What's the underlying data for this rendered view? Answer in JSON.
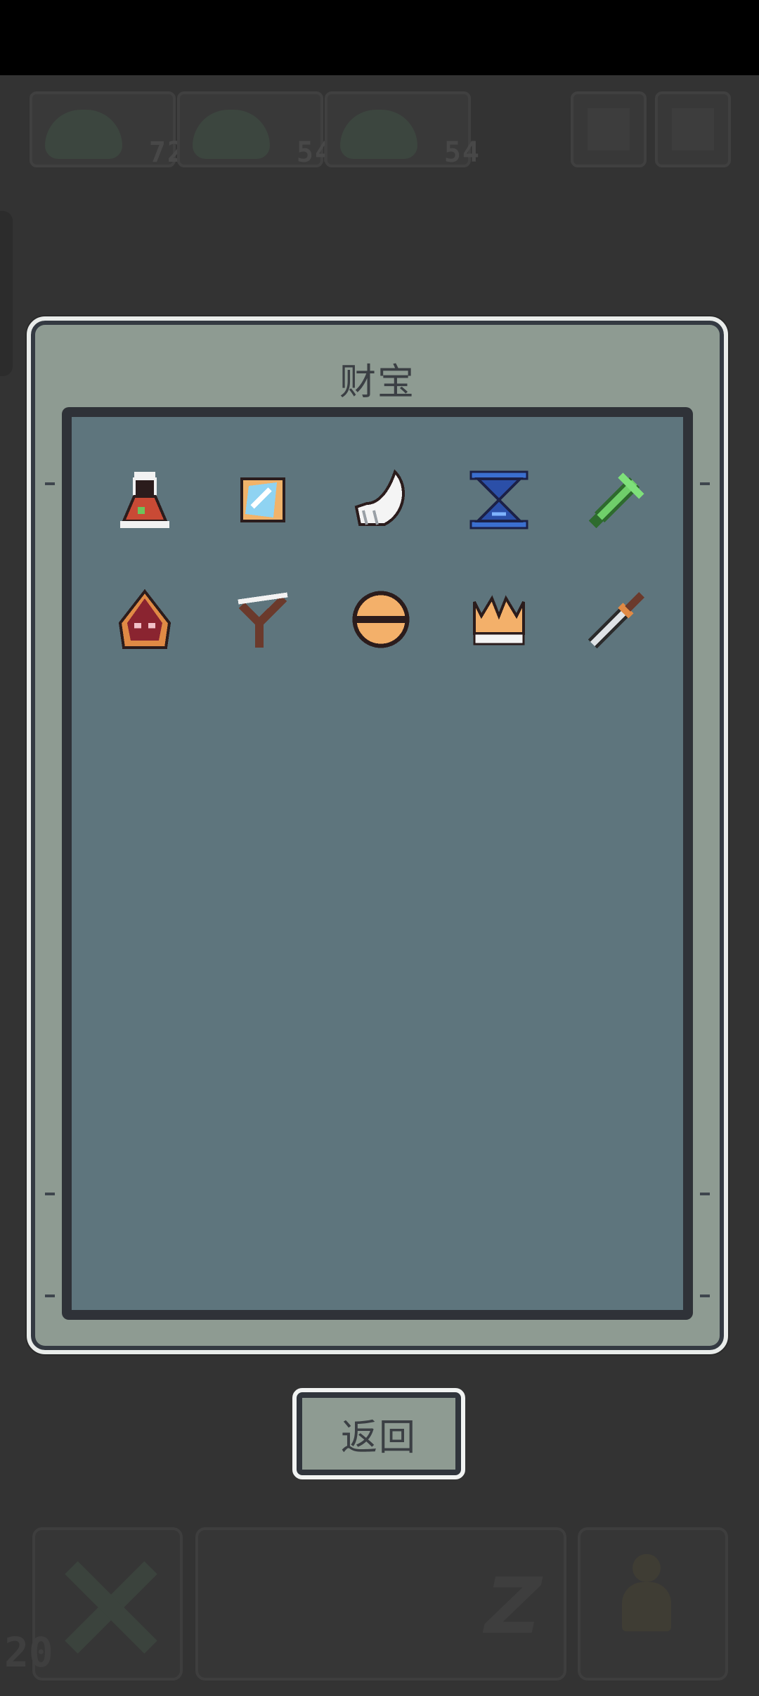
{
  "hud": {
    "party": [
      {
        "name": "slime-1",
        "value": "72"
      },
      {
        "name": "slime-2",
        "value": "54"
      },
      {
        "name": "slime-3",
        "value": "54"
      }
    ],
    "level": "20"
  },
  "modal": {
    "title": "财宝",
    "items": [
      {
        "icon": "red-potion-icon"
      },
      {
        "icon": "magic-mirror-icon"
      },
      {
        "icon": "white-claw-icon"
      },
      {
        "icon": "blue-hourglass-icon"
      },
      {
        "icon": "green-sword-icon"
      },
      {
        "icon": "red-hood-icon"
      },
      {
        "icon": "slingshot-icon"
      },
      {
        "icon": "orange-disc-icon"
      },
      {
        "icon": "golden-crown-icon"
      },
      {
        "icon": "steel-dagger-icon"
      }
    ]
  },
  "back_button": {
    "label": "返回"
  },
  "colors": {
    "panel": "#8e9b92",
    "inner": "#5e757d",
    "border": "#2f3238",
    "background": "#333333"
  }
}
